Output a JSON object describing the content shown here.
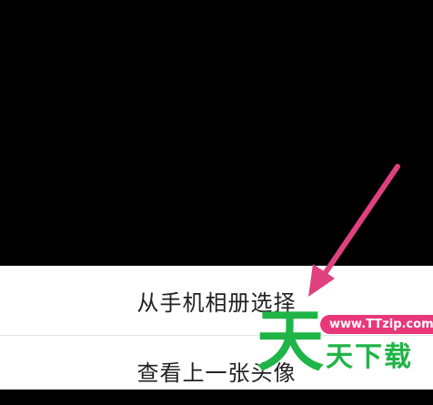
{
  "sheet": {
    "items": [
      {
        "label": "从手机相册选择"
      },
      {
        "label": "查看上一张头像"
      }
    ]
  },
  "watermark": {
    "big_char": "天",
    "pill_text": "www.TTzip.com",
    "small_text": "天下载"
  },
  "colors": {
    "backdrop": "#000000",
    "sheet": "#ffffff",
    "arrow": "#e0407e",
    "watermark_green": "#1fb447",
    "watermark_pill": "#e8387a"
  },
  "icons": {
    "annotation": "arrow-icon"
  }
}
